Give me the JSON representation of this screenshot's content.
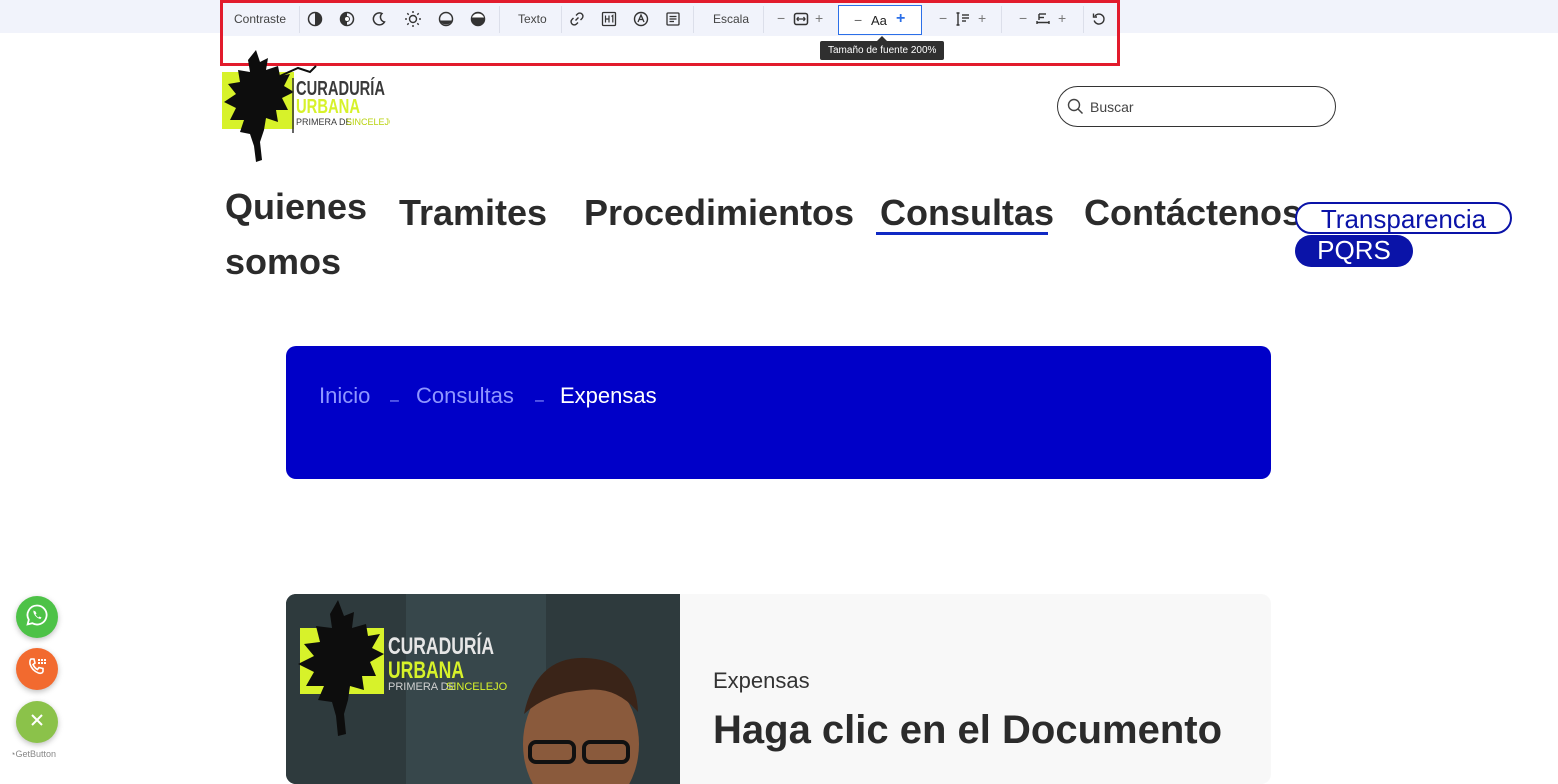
{
  "toolbar": {
    "contrast_label": "Contraste",
    "text_label": "Texto",
    "scale_label": "Escala",
    "font_size_sample": "Aa",
    "minus": "−",
    "plus": "+",
    "tooltip": "Tamaño de fuente 200%",
    "icons": [
      "contrast-icon",
      "invert-colors-icon",
      "dark-mode-icon",
      "light-mode-icon",
      "low-saturation-icon",
      "high-saturation-icon",
      "link-highlight-icon",
      "heading-icon",
      "readable-font-icon",
      "text-magnifier-icon",
      "zoom-icon",
      "line-height-icon",
      "letter-spacing-icon",
      "reset-icon"
    ]
  },
  "header": {
    "logo_text": {
      "line1": "CURADURÍA",
      "line2": "URBANA",
      "line3a": "PRIMERA DE",
      "line3b": "SINCELEJO"
    },
    "search_placeholder": "Buscar"
  },
  "nav": {
    "items": [
      "Quienes",
      "somos",
      "Tramites",
      "Procedimientos",
      "Consultas",
      "Contáctenos"
    ],
    "active": "Consultas",
    "transparencia": "Transparencia",
    "pqrs": "PQRS"
  },
  "breadcrumb": {
    "home": "Inicio",
    "section": "Consultas",
    "current": "Expensas",
    "separator": "–"
  },
  "card": {
    "kicker": "Expensas",
    "title": "Haga clic en el Documento"
  },
  "floating": {
    "brand": "GetButton"
  },
  "colors": {
    "accent_blue": "#0000c8",
    "nav_blue": "#0a13a8",
    "logo_yellow": "#d7f22a",
    "highlight_red": "#e21b2c"
  }
}
